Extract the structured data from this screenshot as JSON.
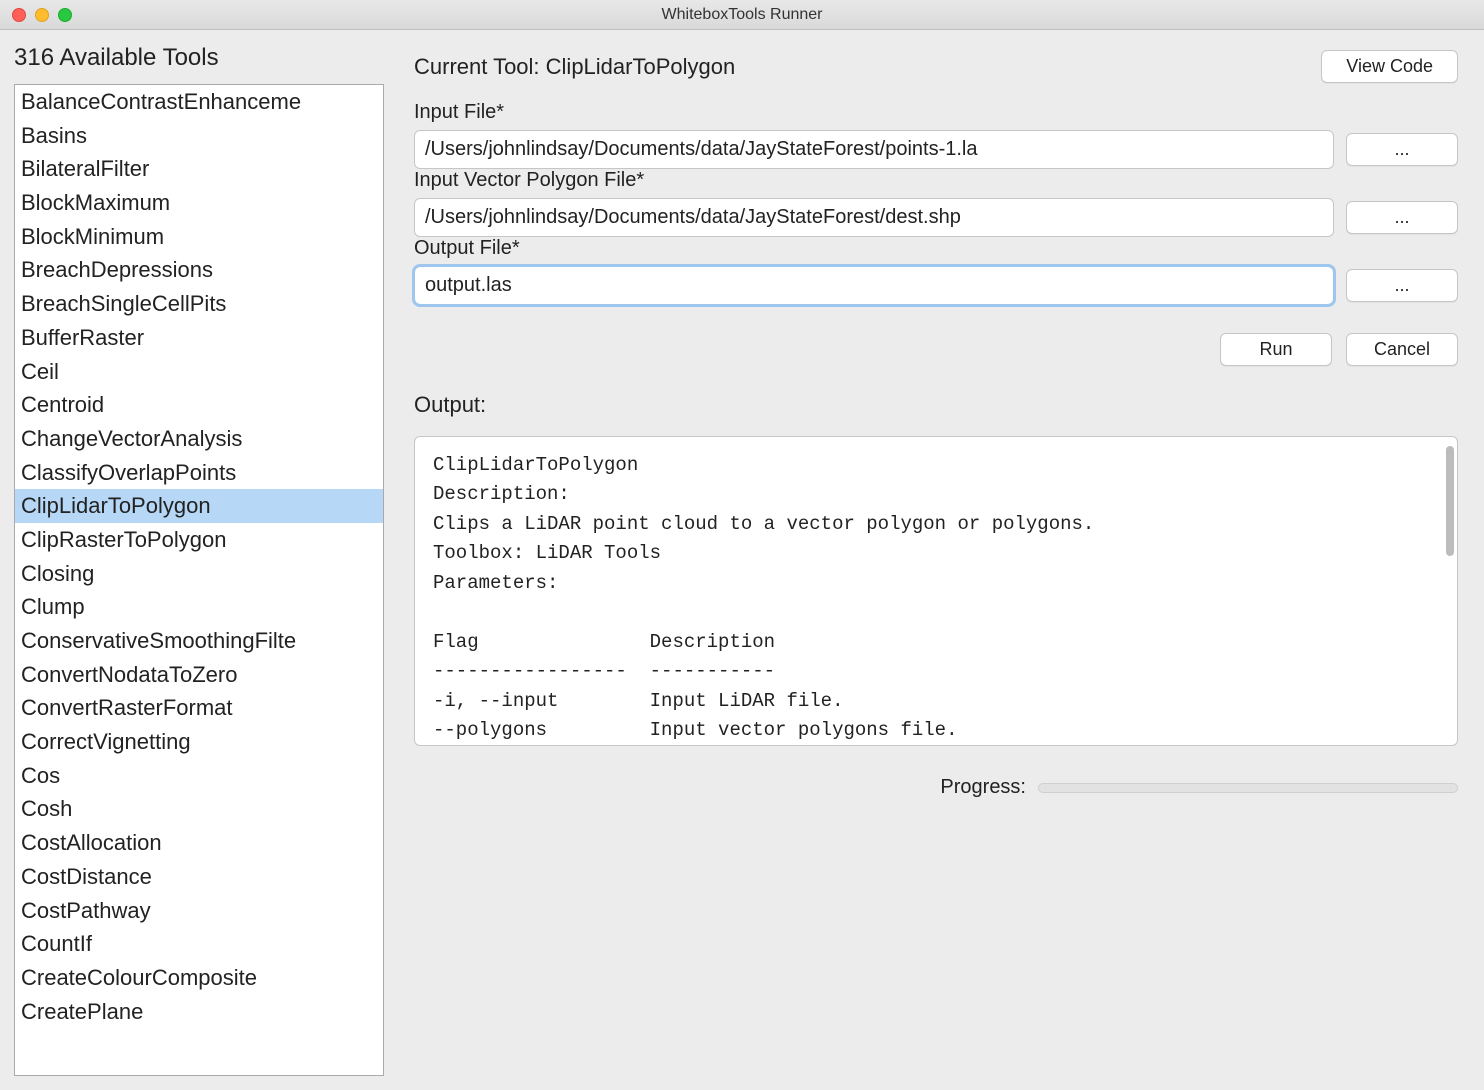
{
  "window": {
    "title": "WhiteboxTools Runner"
  },
  "sidebar": {
    "title": "316 Available Tools",
    "selected": "ClipLidarToPolygon",
    "items": [
      "BalanceContrastEnhanceme",
      "Basins",
      "BilateralFilter",
      "BlockMaximum",
      "BlockMinimum",
      "BreachDepressions",
      "BreachSingleCellPits",
      "BufferRaster",
      "Ceil",
      "Centroid",
      "ChangeVectorAnalysis",
      "ClassifyOverlapPoints",
      "ClipLidarToPolygon",
      "ClipRasterToPolygon",
      "Closing",
      "Clump",
      "ConservativeSmoothingFilte",
      "ConvertNodataToZero",
      "ConvertRasterFormat",
      "CorrectVignetting",
      "Cos",
      "Cosh",
      "CostAllocation",
      "CostDistance",
      "CostPathway",
      "CountIf",
      "CreateColourComposite",
      "CreatePlane"
    ]
  },
  "main": {
    "current_tool_prefix": "Current Tool: ",
    "current_tool": "ClipLidarToPolygon",
    "view_code_label": "View Code",
    "params": [
      {
        "label": "Input File*",
        "value": "/Users/johnlindsay/Documents/data/JayStateForest/points-1.la",
        "browse": "...",
        "focused": false
      },
      {
        "label": "Input Vector Polygon File*",
        "value": "/Users/johnlindsay/Documents/data/JayStateForest/dest.shp",
        "browse": "...",
        "focused": false
      },
      {
        "label": "Output File*",
        "value": "output.las",
        "browse": "...",
        "focused": true
      }
    ],
    "actions": {
      "run": "Run",
      "cancel": "Cancel"
    },
    "output_label": "Output:",
    "output_text": "ClipLidarToPolygon\nDescription:\nClips a LiDAR point cloud to a vector polygon or polygons.\nToolbox: LiDAR Tools\nParameters:\n\nFlag               Description\n-----------------  -----------\n-i, --input        Input LiDAR file.\n--polygons         Input vector polygons file.",
    "progress_label": "Progress:"
  }
}
